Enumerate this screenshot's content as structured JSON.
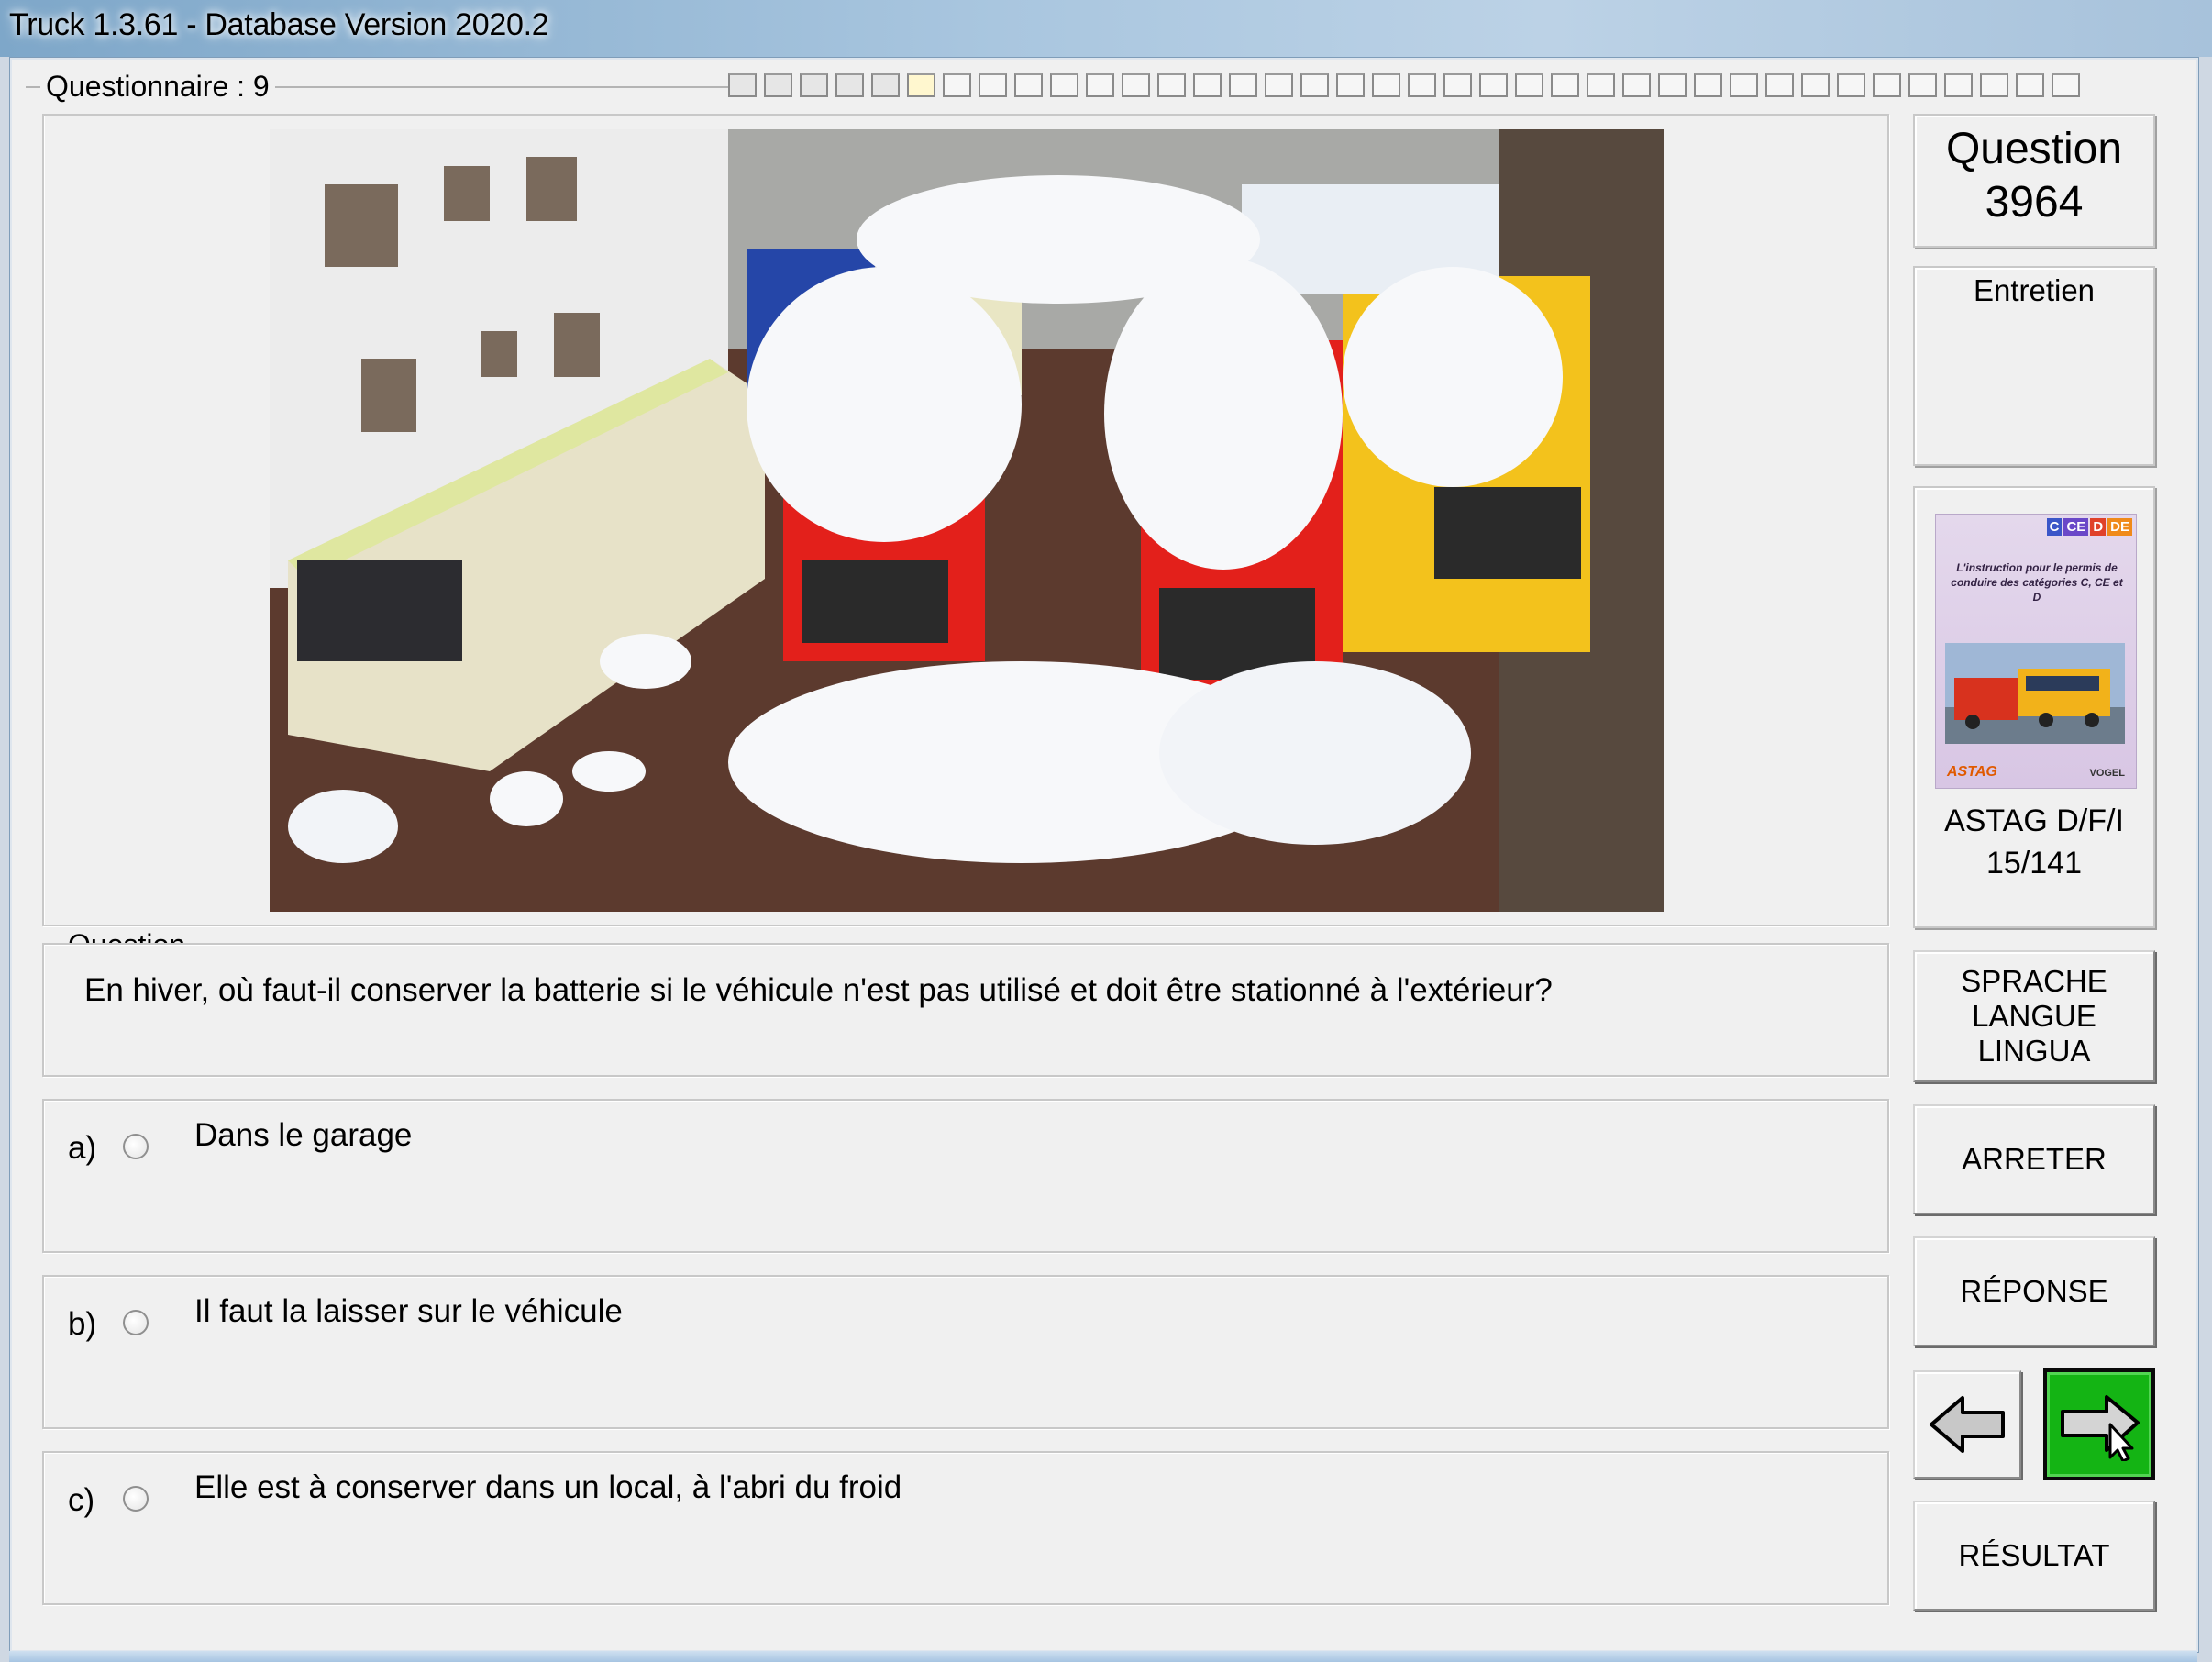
{
  "window": {
    "title": "Truck 1.3.61 - Database Version 2020.2"
  },
  "questionnaire": {
    "label": "Questionnaire : 9",
    "progress": {
      "total": 38,
      "completed": 5,
      "current_index": 5
    }
  },
  "question": {
    "section_label": "Question",
    "text": "En hiver, où faut-il conserver la batterie si le véhicule n'est pas utilisé et doit être stationné à l'extérieur?",
    "image_icon": "photo-snow-covered-buses"
  },
  "answers": [
    {
      "letter": "a)",
      "text": "Dans le garage",
      "selected": false
    },
    {
      "letter": "b)",
      "text": "Il faut la laisser sur le véhicule",
      "selected": false
    },
    {
      "letter": "c)",
      "text": "Elle est à conserver dans un local, à l'abri du froid",
      "selected": false
    }
  ],
  "sidebar": {
    "question_word": "Question",
    "question_number": "3964",
    "category": "Entretien",
    "book": {
      "tabs": [
        "C",
        "CE",
        "D",
        "DE"
      ],
      "tab_colors": [
        "#3a56c8",
        "#6a48c8",
        "#e0422a",
        "#f08a1a"
      ],
      "cover_text": "L'instruction pour le permis de conduire des catégories C, CE et D",
      "logo_left": "ASTAG",
      "logo_right": "VOGEL",
      "publisher": "ASTAG D/F/I",
      "page": "15/141"
    },
    "language_button": [
      "SPRACHE",
      "LANGUE",
      "LINGUA"
    ],
    "stop_button": "ARRETER",
    "answer_button": "RÉPONSE",
    "back_icon": "arrow-left-icon",
    "next_icon": "arrow-right-icon",
    "next_color": "#14b414",
    "result_button": "RÉSULTAT"
  }
}
